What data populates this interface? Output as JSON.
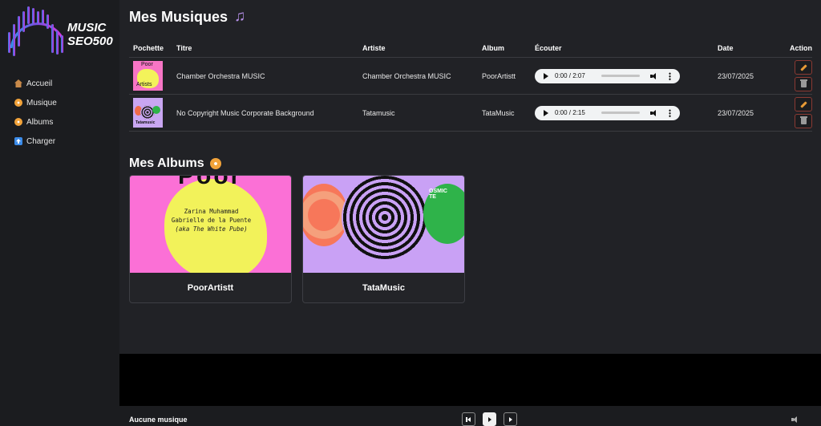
{
  "app": {
    "logo_text_line1": "MUSIC",
    "logo_text_line2": "SEO500",
    "colors": {
      "accent": "#b48ee6",
      "danger_border": "#8a3a33",
      "edit": "#e79a36"
    }
  },
  "sidebar": {
    "items": [
      {
        "icon": "home-icon",
        "label": "Accueil"
      },
      {
        "icon": "disc-icon",
        "label": "Musique"
      },
      {
        "icon": "disc-icon",
        "label": "Albums"
      },
      {
        "icon": "upload-icon",
        "label": "Charger"
      }
    ]
  },
  "music": {
    "title": "Mes Musiques",
    "columns": {
      "cover": "Pochette",
      "title": "Titre",
      "artist": "Artiste",
      "album": "Album",
      "listen": "Écouter",
      "date": "Date",
      "action": "Action"
    },
    "rows": [
      {
        "cover_text_top": "Poor",
        "cover_text_bottom": "Artists",
        "title": "Chamber Orchestra MUSIC",
        "artist": "Chamber Orchestra MUSIC",
        "album": "PoorArtistt",
        "audio_time": "0:00 / 2:07",
        "audio_progress": 0,
        "date": "23/07/2025"
      },
      {
        "cover_text": "Tatamusic",
        "title": "No Copyright Music Corporate Background",
        "artist": "Tatamusic",
        "album": "TataMusic",
        "audio_time": "0:00 / 2:15",
        "audio_progress": 0,
        "date": "23/07/2025"
      }
    ]
  },
  "albums": {
    "title": "Mes Albums",
    "items": [
      {
        "name": "PoorArtistt",
        "cover_big_text": "Poor",
        "cover_line1": "Zarina Muhammad",
        "cover_line2": "Gabrielle de la Puente",
        "cover_line3": "(aka The White Pube)"
      },
      {
        "name": "TataMusic",
        "cover_text": "OSMIC\nTE"
      }
    ]
  },
  "player": {
    "now_playing": "Aucune musique"
  }
}
